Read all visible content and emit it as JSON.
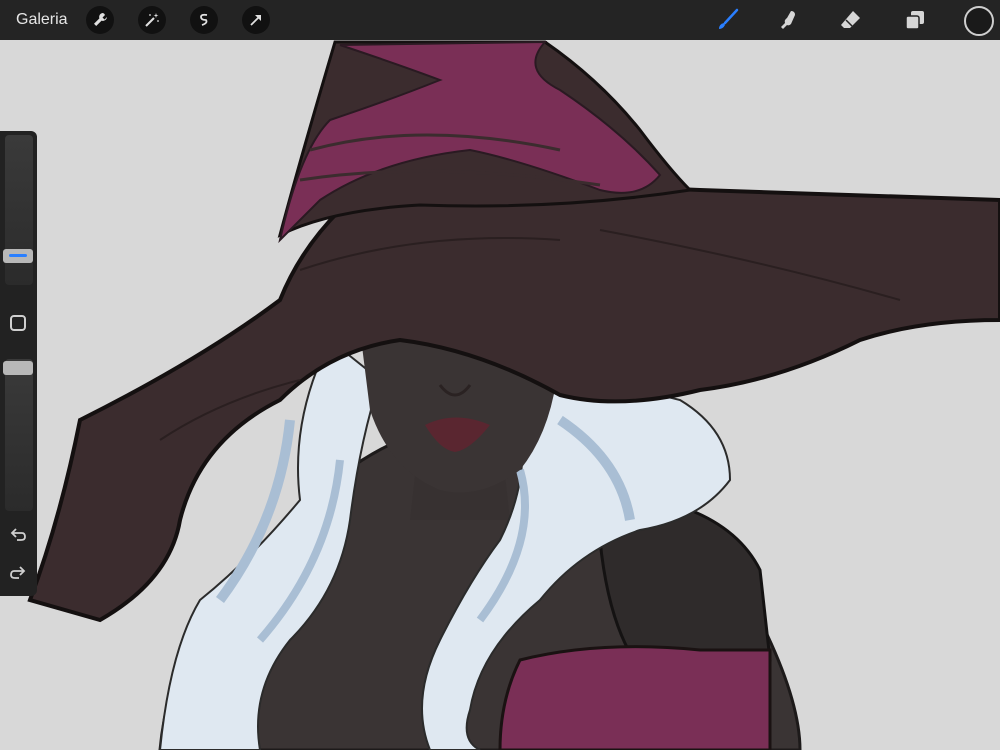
{
  "toolbar": {
    "gallery_label": "Galeria",
    "left_tools": [
      "wrench-icon",
      "magic-wand-icon",
      "selection-icon",
      "transform-arrow-icon"
    ],
    "right_tools": [
      "brush-icon",
      "smudge-icon",
      "eraser-icon",
      "layers-icon"
    ],
    "active_tool": "brush-icon",
    "accent_color": "#2a7fff",
    "current_color": "#1a1a1a"
  },
  "sidebar": {
    "brush_size_level": 0.2,
    "opacity_level": 1.0,
    "icons": [
      "modify-square-icon",
      "undo-icon",
      "redo-icon"
    ]
  },
  "canvas": {
    "background_color": "#d8d8d8",
    "hat_color": "#3b2c2e",
    "band_color": "#7a2f56",
    "hair_color": "#dfe8f1",
    "skin_color": "#3a3434"
  }
}
